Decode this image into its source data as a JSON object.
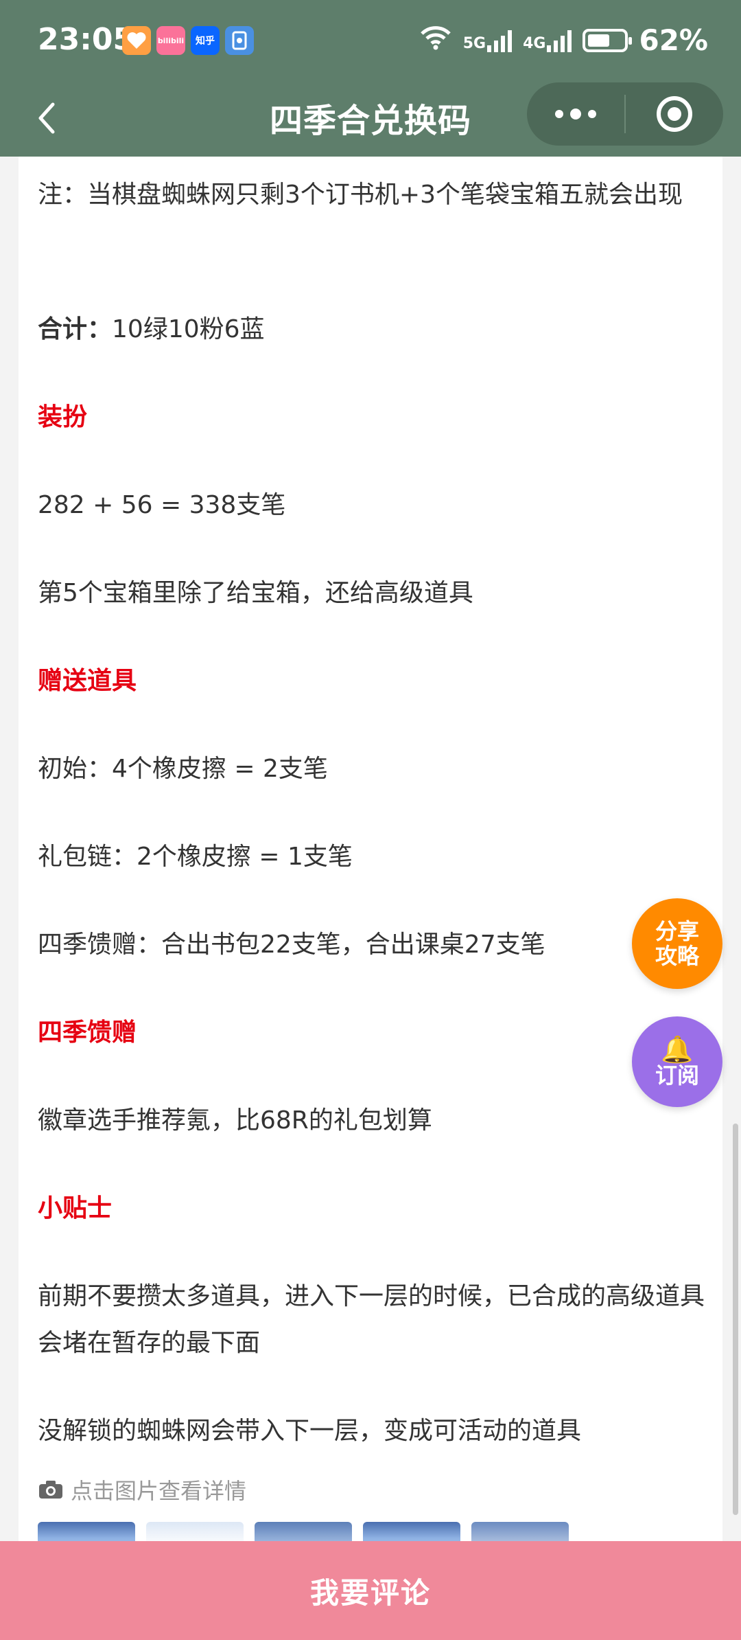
{
  "status_bar": {
    "time": "23:05",
    "app_icons": [
      "like-icon",
      "bilibili-icon",
      "zhihu-icon",
      "phone-icon"
    ],
    "bilibili_text": "bilibili",
    "zhihu_text": "知乎",
    "signal_5g": "5G",
    "signal_4g": "4G",
    "battery_percent": "62%",
    "battery_level": 0.62
  },
  "nav": {
    "title": "四季合兑换码"
  },
  "article": {
    "note": "注：当棋盘蜘蛛网只剩3个订书机+3个笔袋宝箱五就会出现",
    "total_label": "合计：",
    "total_value": "10绿10粉6蓝",
    "section_outfit": "装扮",
    "outfit_calc": "282 + 56 = 338支笔",
    "chest_note": "第5个宝箱里除了给宝箱，还给高级道具",
    "section_gift": "赠送道具",
    "gift_initial": "初始：4个橡皮擦 = 2支笔",
    "gift_chain": "礼包链：2个橡皮擦 = 1支笔",
    "gift_season": "四季馈赠：合出书包22支笔，合出课桌27支笔",
    "section_season": "四季馈赠",
    "season_text": "徽章选手推荐氪，比68R的礼包划算",
    "section_tips": "小贴士",
    "tip1": "前期不要攒太多道具，进入下一层的时候，已合成的高级道具会堵在暂存的最下面",
    "tip2": "没解锁的蜘蛛网会带入下一层，变成可活动的道具",
    "photo_hint": "点击图片查看详情"
  },
  "fabs": {
    "share_line1": "分享",
    "share_line2": "攻略",
    "subscribe": "订阅"
  },
  "bottom": {
    "comment_button": "我要评论"
  },
  "colors": {
    "header_bg": "#5e7e6b",
    "section_red": "#e60012",
    "share_orange": "#ff8a00",
    "subscribe_purple": "#9b6fe8",
    "comment_pink": "#f0899a"
  }
}
